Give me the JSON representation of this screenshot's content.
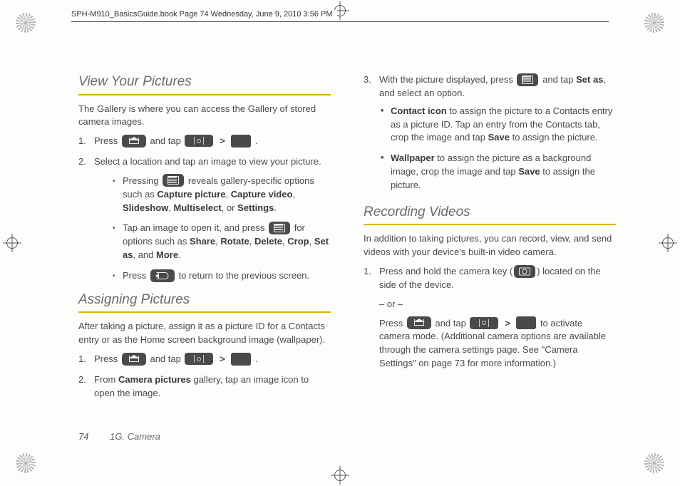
{
  "header": "SPH-M910_BasicsGuide.book  Page 74  Wednesday, June 9, 2010  3:56 PM",
  "footer": {
    "page": "74",
    "chapter": "1G. Camera"
  },
  "s1": {
    "title": "View Your Pictures",
    "intro": "The Gallery is where you can access the Gallery of stored camera images.",
    "step1a": "Press ",
    "step1b": " and tap ",
    "step1c": ".",
    "step2": "Select a location and tap an image to view your picture.",
    "b1a": "Pressing ",
    "b1b": " reveals gallery-specific options such as ",
    "opt_capture_pic": "Capture picture",
    "opt_capture_vid": "Capture video",
    "opt_slideshow": "Slideshow",
    "opt_multiselect": "Multiselect",
    "or": ", or ",
    "opt_settings": "Settings",
    "b2a": "Tap an image to open it, and press ",
    "b2b": " for options such as ",
    "opt_share": "Share",
    "opt_rotate": "Rotate",
    "opt_delete": "Delete",
    "opt_crop": "Crop",
    "opt_setas": "Set as",
    "and": ", and ",
    "opt_more": "More",
    "b3a": "Press ",
    "b3b": " to return to the previous screen."
  },
  "s2": {
    "title": "Assigning Pictures",
    "intro": "After taking a picture, assign it as a picture ID for a Contacts entry or as the Home screen background image (wallpaper).",
    "step1a": "Press ",
    "step1b": " and tap ",
    "step1c": ".",
    "step2a": "From ",
    "step2_gal": "Camera pictures",
    "step2b": " gallery, tap an image icon to open the image."
  },
  "s3": {
    "step3a": "With the picture displayed, press ",
    "step3b": " and tap ",
    "step3_setas": "Set as",
    "step3c": ", and select an option.",
    "ci_label": "Contact icon",
    "ci_text": " to assign the picture to a Contacts entry as a picture ID. Tap an entry from the Contacts tab, crop the image and tap ",
    "save": "Save",
    "ci_text2": " to assign the picture.",
    "wp_label": "Wallpaper",
    "wp_text": " to assign the picture as a background image, crop the image and tap ",
    "wp_text2": " to assign the picture."
  },
  "s4": {
    "title": "Recording Videos",
    "intro": "In addition to taking pictures, you can record, view, and send videos with your device's built-in video camera.",
    "step1a": "Press and hold the camera key (",
    "step1b": ") located on the side of the device.",
    "or": "– or –",
    "alt1a": "Press ",
    "alt1b": " and tap ",
    "alt1c": "  to activate camera mode. (Additional camera options are available through the camera settings page. See \"Camera Settings\" on page 73 for more information.)"
  },
  "gt": ">"
}
